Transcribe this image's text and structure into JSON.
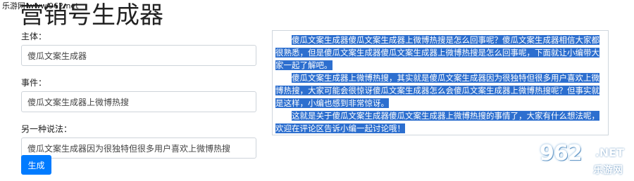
{
  "watermark": {
    "top_left": "乐游网 www.962.net"
  },
  "page": {
    "title": "营销号生成器"
  },
  "form": {
    "subject": {
      "label": "主体：",
      "value": "傻瓜文案生成器"
    },
    "event": {
      "label": "事件：",
      "value": "傻瓜文案生成器上微博热搜"
    },
    "alt": {
      "label": "另一种说法：",
      "value": "傻瓜文案生成器因为很独特但很多用户喜欢上微博热搜"
    }
  },
  "generate_button": {
    "label": "生成"
  },
  "output": {
    "paragraphs": [
      "傻瓜文案生成器傻瓜文案生成器上微博热搜是怎么回事呢？傻瓜文案生成器相信大家都很熟悉，但是傻瓜文案生成器傻瓜文案生成器上微博热搜是怎么回事呢，下面就让小编带大家一起了解吧。",
      "傻瓜文案生成器上微博热搜，其实就是傻瓜文案生成器因为很独特但很多用户喜欢上微博热搜，大家可能会很惊讶傻瓜文案生成器怎么会傻瓜文案生成器上微博热搜呢？但事实就是这样，小编也感到非常惊讶。",
      "这就是关于傻瓜文案生成器傻瓜文案生成器上微博热搜的事情了，大家有什么想法呢，欢迎在评论区告诉小编一起讨论哦！"
    ]
  },
  "logo": {
    "number": "962",
    "net": ".NET",
    "sub": "乐游网"
  },
  "colors": {
    "primary_button": "#007bff",
    "selection_highlight": "#2d6fcf",
    "input_border": "#ced4da"
  }
}
